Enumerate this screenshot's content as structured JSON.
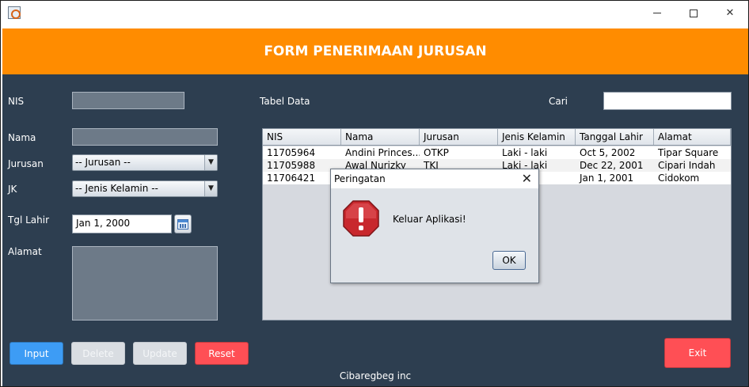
{
  "window": {
    "title": "",
    "controls": {
      "minimize": "—",
      "maximize": "☐",
      "close": "✕"
    }
  },
  "header": {
    "title": "FORM PENERIMAAN JURUSAN"
  },
  "form": {
    "nis_label": "NIS",
    "nama_label": "Nama",
    "jurusan_label": "Jurusan",
    "jk_label": "JK",
    "tgl_label": "Tgl Lahir",
    "alamat_label": "Alamat",
    "jurusan_selected": "-- Jurusan --",
    "jk_selected": "-- Jenis Kelamin --",
    "tgl_value": "Jan 1, 2000"
  },
  "table": {
    "title": "Tabel Data",
    "search_label": "Cari",
    "columns": [
      "NIS",
      "Nama",
      "Jurusan",
      "Jenis Kelamin",
      "Tanggal Lahir",
      "Alamat"
    ],
    "rows": [
      [
        "11705964",
        "Andini Princes...",
        "OTKP",
        "Laki - laki",
        "Oct 5, 2002",
        "Tipar Square"
      ],
      [
        "11705988",
        "Awal Nurizky",
        "TKJ",
        "Laki - laki",
        "Dec 22, 2001",
        "Cipari Indah"
      ],
      [
        "11706421",
        "",
        "",
        "...ki",
        "Jan 1, 2001",
        "Cidokom"
      ]
    ]
  },
  "buttons": {
    "input": "Input",
    "delete": "Delete",
    "update": "Update",
    "reset": "Reset",
    "exit": "Exit"
  },
  "footer": {
    "text": "Cibaregbeg inc"
  },
  "dialog": {
    "title": "Peringatan",
    "message": "Keluar Aplikasi!",
    "ok": "OK",
    "close_glyph": "✕",
    "icon": "error-octagon-icon"
  },
  "colors": {
    "header": "#ff8c00",
    "background": "#2d3e50",
    "input_button": "#3d9cf5",
    "danger_button": "#ff4f55"
  }
}
